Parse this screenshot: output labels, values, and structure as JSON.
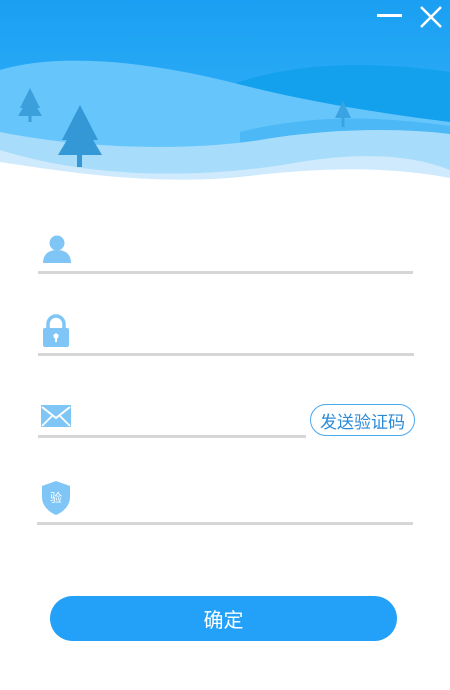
{
  "window": {
    "minimize_icon": "minimize-icon",
    "close_icon": "close-icon"
  },
  "form": {
    "username": {
      "icon": "user-icon",
      "value": "",
      "placeholder": ""
    },
    "password": {
      "icon": "lock-icon",
      "value": "",
      "placeholder": ""
    },
    "email": {
      "icon": "mail-icon",
      "value": "",
      "placeholder": ""
    },
    "verification_code": {
      "icon": "shield-icon",
      "badge_text": "验",
      "value": "",
      "placeholder": ""
    },
    "send_code_label": "发送验证码",
    "confirm_label": "确定"
  },
  "colors": {
    "accent": "#23a0f7",
    "sky": "#1aa3f5",
    "icon": "#7fc6f7",
    "underline": "#d6d6d6"
  }
}
